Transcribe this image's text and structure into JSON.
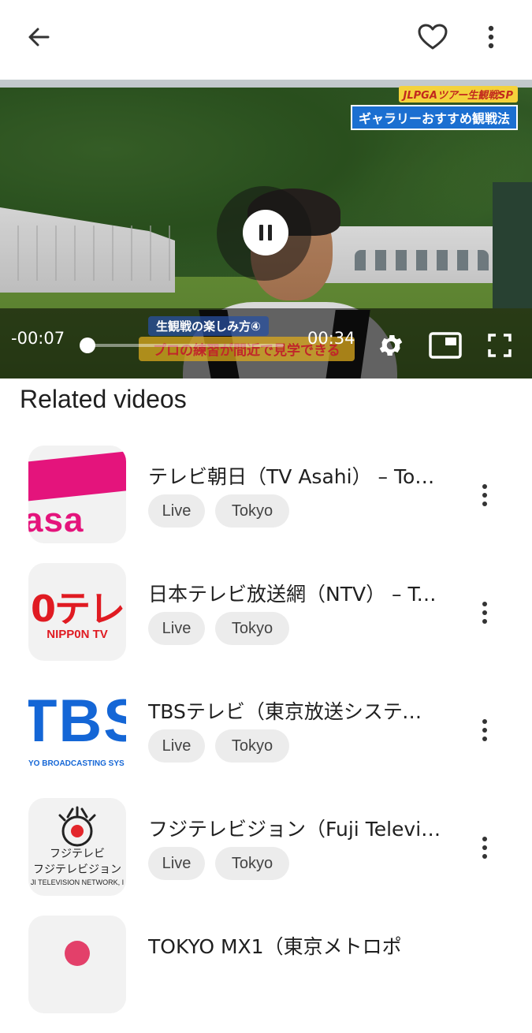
{
  "topbar": {
    "icons": [
      "back-arrow-icon",
      "heart-icon",
      "more-vertical-icon"
    ]
  },
  "player": {
    "overlay": {
      "small_caption": "JLPGAツアー生観戦SP",
      "big_caption": "ギャラリーおすすめ観戦法",
      "lower_caption_1": "生観戦の楽しみ方④",
      "lower_caption_2": "プロの練習が間近で見学できる"
    },
    "time_remaining": "-00:07",
    "time_total": "00:34",
    "progress_fraction": 0.0,
    "state_icon": "pause-icon",
    "control_icons": [
      "settings-gear-icon",
      "picture-in-picture-icon",
      "fullscreen-icon"
    ]
  },
  "related": {
    "title": "Related videos",
    "items": [
      {
        "title": "テレビ朝日（TV Asahi） – Tokyo",
        "tags": [
          "Live",
          "Tokyo"
        ],
        "thumb": {
          "text": "asa",
          "color": "#e4147c"
        }
      },
      {
        "title": "日本テレビ放送網（NTV） – Tokyo",
        "tags": [
          "Live",
          "Tokyo"
        ],
        "thumb": {
          "big": "0テレ",
          "small": "NIPP0N TV",
          "color": "#e01b22"
        }
      },
      {
        "title": "TBSテレビ（東京放送システム）",
        "tags": [
          "Live",
          "Tokyo"
        ],
        "thumb": {
          "big": "TBS",
          "small": "YO BROADCASTING SYS",
          "color": "#1466d6"
        }
      },
      {
        "title": "フジテレビジョン（Fuji Television）",
        "tags": [
          "Live",
          "Tokyo"
        ],
        "thumb": {
          "line1": "フジテレビ",
          "line2": "フジテレビジョン",
          "line3": "JI TELEVISION NETWORK, I"
        }
      },
      {
        "title": "TOKYO MX1（東京メトロポ",
        "tags": [],
        "thumb": {
          "color": "#e3406a"
        }
      }
    ]
  }
}
